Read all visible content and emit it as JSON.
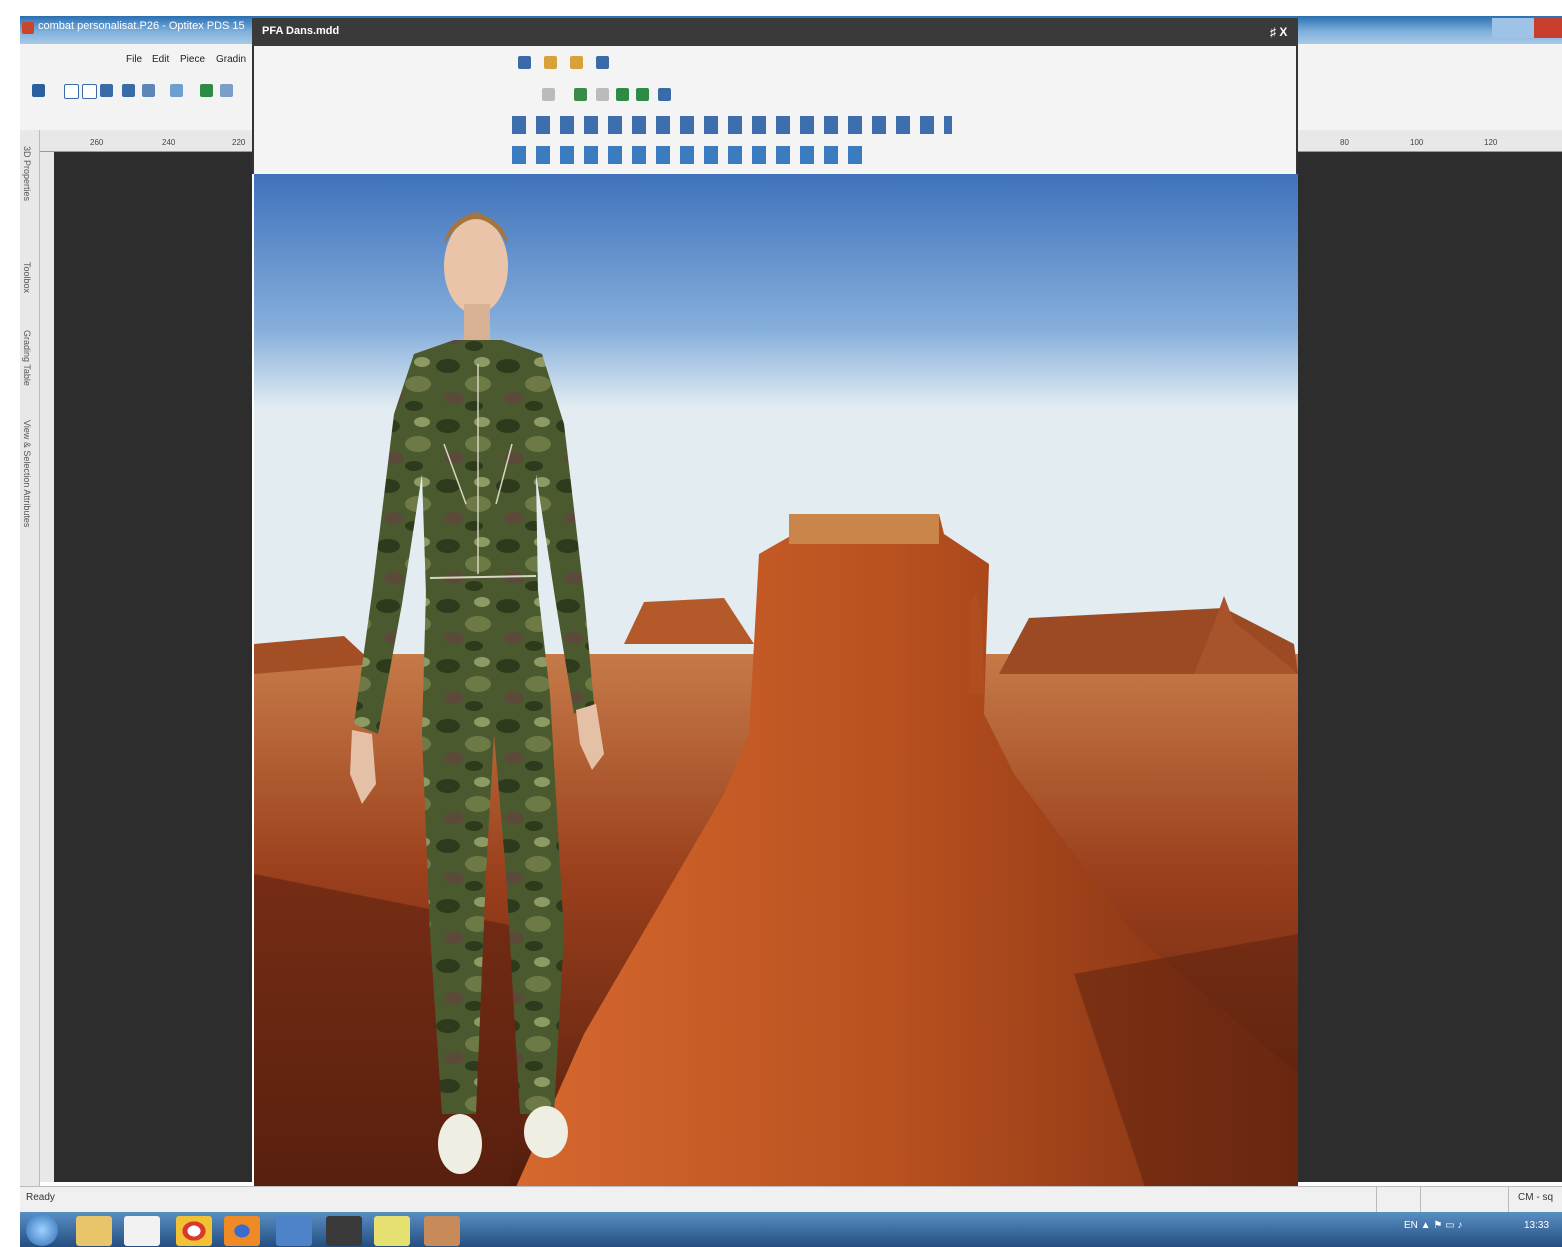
{
  "app": {
    "title": "combat personalisat.P26 - Optitex PDS 15",
    "menu": [
      "File",
      "Edit",
      "Piece",
      "Gradin"
    ]
  },
  "rulers": {
    "left_ticks": [
      "260",
      "240",
      "220"
    ],
    "right_ticks": [
      "80",
      "100",
      "120"
    ]
  },
  "sidebar": {
    "panels": [
      "3D Properties",
      "Toolbox",
      "Grading Table",
      "View & Selection Attributes"
    ]
  },
  "pfa_window": {
    "title": "PFA Dans.mdd",
    "controls": "♯ X"
  },
  "status": {
    "text": "Ready",
    "units": "CM - sq"
  },
  "taskbar": {
    "tray_text": "EN ▲ ⚑ ▭ ♪",
    "clock": "13:33"
  },
  "colors": {
    "titlebar": "#2a6fb1",
    "workspace": "#2d2d2d",
    "pfa_title": "#3a3a3a",
    "sky": "#3f72bb",
    "rock": "#b1552a",
    "camo_green": "#4b5a2e"
  },
  "icons": [
    "windows-start-icon",
    "explorer-icon",
    "media-player-icon",
    "chrome-icon",
    "firefox-icon",
    "network-icon",
    "app-icon",
    "optitex-icon",
    "character-icon"
  ]
}
